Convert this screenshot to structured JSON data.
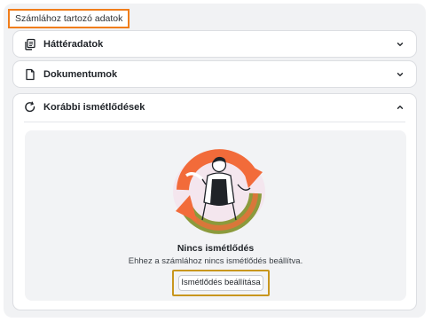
{
  "section": {
    "title": "Számlához tartozó adatok"
  },
  "cards": [
    {
      "label": "Háttéradatok",
      "icon": "documents-icon",
      "expanded": false
    },
    {
      "label": "Dokumentumok",
      "icon": "document-icon",
      "expanded": false
    },
    {
      "label": "Korábbi ismétlődések",
      "icon": "refresh-icon",
      "expanded": true
    }
  ],
  "empty_state": {
    "title": "Nincs ismétlődés",
    "description": "Ehhez a számlához nincs ismétlődés beállítva.",
    "button_label": "Ismétlődés beállítása"
  },
  "colors": {
    "accent_orange": "#f07d1a",
    "highlight_gold": "#c8961e",
    "arrow_orange": "#f26b3a",
    "arrow_olive": "#8b9a3c"
  }
}
